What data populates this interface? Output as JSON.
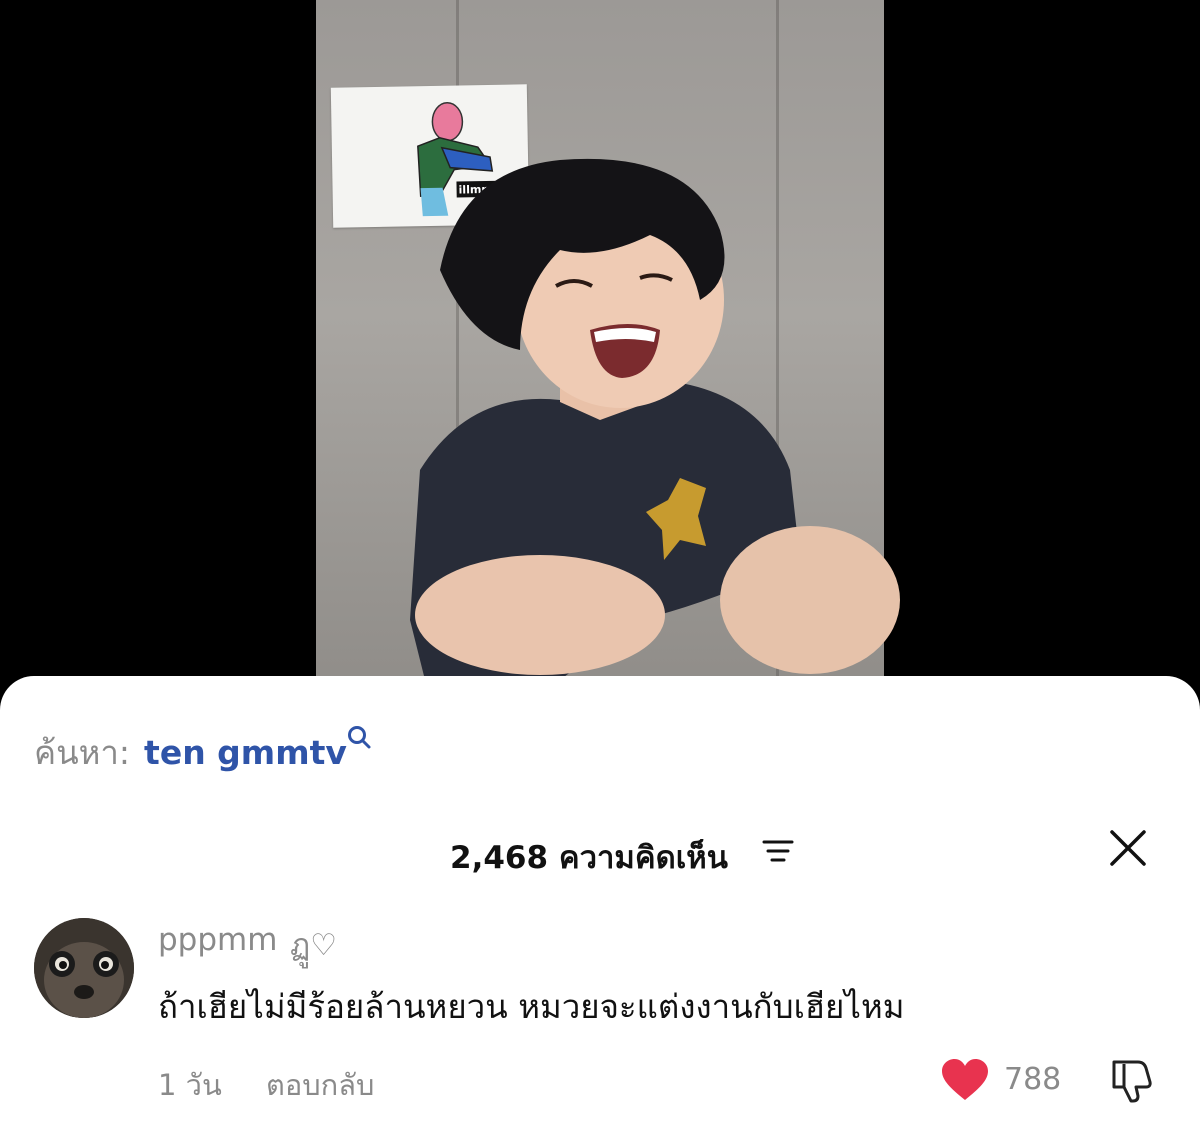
{
  "search": {
    "prefix": "ค้นหา:",
    "query": "ten gmmtv"
  },
  "comments": {
    "count_label": "2,468 ความคิดเห็น"
  },
  "comment": {
    "username": "pppmm",
    "username_deco": "ฏู♡",
    "text": "ถ้าเฮียไม่มีร้อยล้านหยวน หมวยจะแต่งงานกับเฮียไหม",
    "time": "1 วัน",
    "reply_label": "ตอบกลับ",
    "likes": "788"
  },
  "poster": {
    "label": "illmnt"
  },
  "icons": {
    "search": "search-icon",
    "sort": "sort-icon",
    "close": "close-icon",
    "like": "heart-icon",
    "dislike": "thumbs-down-icon"
  },
  "colors": {
    "query": "#2f54a8",
    "like": "#e8334f",
    "muted": "#8a8a8a"
  }
}
